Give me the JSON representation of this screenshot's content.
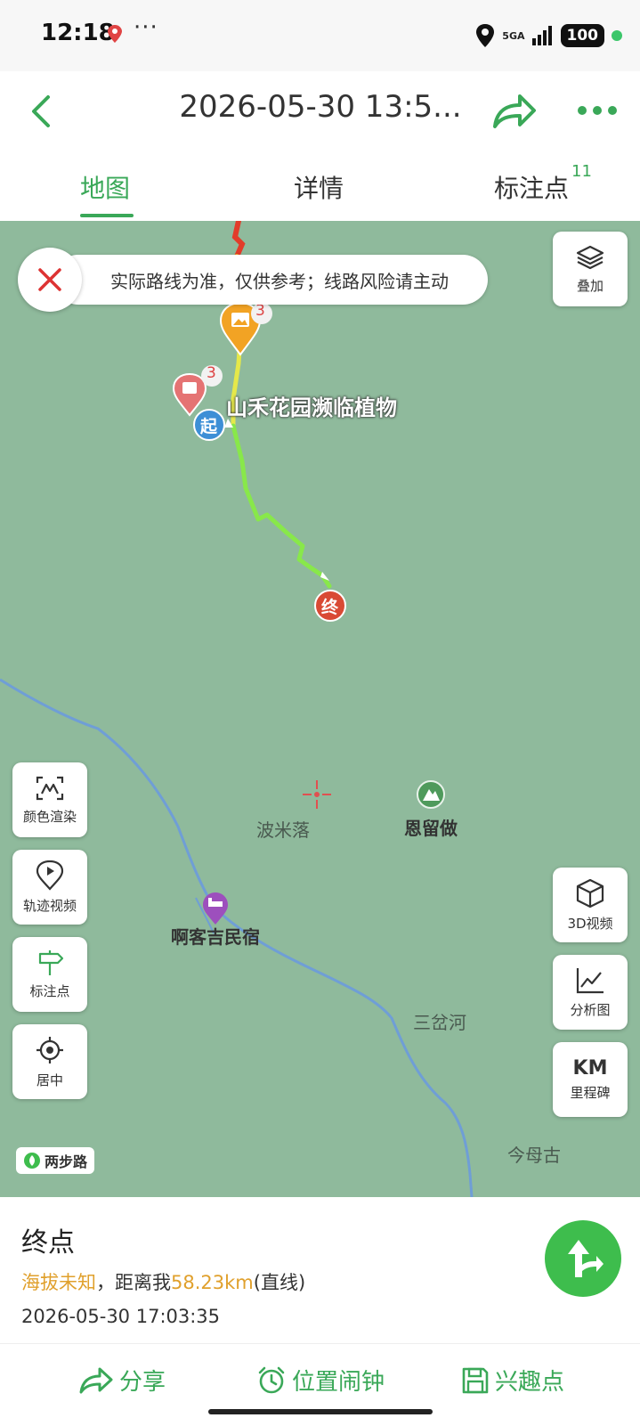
{
  "status_bar": {
    "time": "12:18",
    "dots": "···",
    "network": "5GA",
    "battery": "100"
  },
  "header": {
    "title": "2026-05-30 13:5..."
  },
  "tabs": {
    "map": "地图",
    "detail": "详情",
    "marks": "标注点",
    "marks_count": "11"
  },
  "map": {
    "notice": "实际路线为准，仅供参考；线路风险请主动",
    "layers_label": "叠加",
    "route_label": "山禾花园濒临植物",
    "start_marker": "起",
    "end_marker": "终",
    "photo_count_1": "3",
    "photo_count_2": "3",
    "places": {
      "bomiluo": "波米落",
      "enliuzuo": "恩留做",
      "akeji": "啊客吉民宿",
      "sanchahe": "三岔河",
      "jinmugu": "今母古"
    },
    "left_buttons": {
      "color": "颜色渲染",
      "video": "轨迹视频",
      "marks": "标注点",
      "center": "居中"
    },
    "right_buttons": {
      "video3d": "3D视频",
      "analysis": "分析图",
      "km": "KM",
      "milestone": "里程碑"
    },
    "brand": "两步路"
  },
  "info": {
    "title": "终点",
    "altitude": "海拔未知",
    "sep": "，距离我",
    "distance": "58.23km",
    "straight": "(直线)",
    "datetime": "2026-05-30 17:03:35"
  },
  "actions": {
    "share": "分享",
    "alarm": "位置闹钟",
    "poi": "兴趣点"
  },
  "colors": {
    "accent": "#3aa858",
    "map_bg": "#8fba9c",
    "orange": "#e0a02c",
    "end_red": "#d94a34",
    "start_blue": "#3d8fd6"
  }
}
